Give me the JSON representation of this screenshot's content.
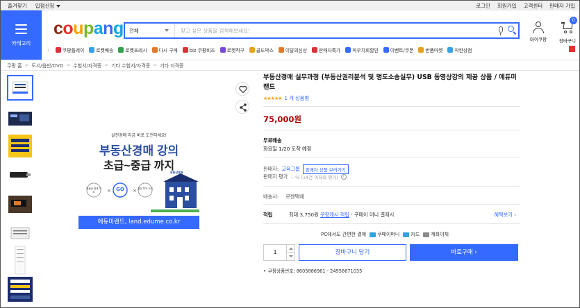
{
  "topbar": {
    "left": [
      "즐겨찾기",
      "입점신청"
    ],
    "right": [
      "로그인",
      "회원가입",
      "고객센터",
      "판매자 가입"
    ]
  },
  "category": {
    "label": "카테고리"
  },
  "logo": {
    "text": "coupang"
  },
  "search": {
    "category": "전체",
    "placeholder": "찾고 싶은 상품을 검색해보세요!"
  },
  "user": {
    "mycoupang": "마이쿠팡",
    "cart": "장바구니",
    "cart_count": "0"
  },
  "quick_nav": [
    {
      "label": "쿠팡플레이",
      "color": "#d6333a"
    },
    {
      "label": "로켓배송",
      "color": "#3aa0e6"
    },
    {
      "label": "로켓프레시",
      "color": "#2fa24a"
    },
    {
      "label": "다시 구매",
      "color": "#e07a2a"
    },
    {
      "label": "biz 쿠팡비즈",
      "color": "#d6333a"
    },
    {
      "label": "로켓직구",
      "color": "#7a4ad6"
    },
    {
      "label": "골드박스",
      "color": "#e5a21a"
    },
    {
      "label": "이달의신상",
      "color": "#e07a2a"
    },
    {
      "label": "판매자특가",
      "color": "#d6333a"
    },
    {
      "label": "파우치회할인",
      "color": "#346aff"
    },
    {
      "label": "이벤트/쿠폰",
      "color": "#346aff"
    },
    {
      "label": "반품마켓",
      "color": "#e5a21a"
    },
    {
      "label": "착한상점",
      "color": "#3aa0e6"
    }
  ],
  "breadcrumbs": [
    "쿠팡 홈",
    "도서/음반/DVD",
    "수험서/자격증",
    "기타 수험서/자격증",
    "기타 자격증"
  ],
  "product": {
    "title": "부동산경매 실무과정 (부동산권리분석 및 명도소송실무) USB 동영상강의 제공 상품 / 에듀미랜드",
    "stars": "★★★★★",
    "review_count": "1 개 상품평",
    "price": "75,000원",
    "shipping_label": "무료배송",
    "shipping_date": "화요일 1/20 도착 예정",
    "seller_label": "판매자:",
    "seller_name": "교육그룹",
    "seller_chip": "판매자 상품 보러가기",
    "score_label": "판매자 평가",
    "score_value": "-- % (14건 이하의 평가)",
    "delivery_label": "배송사:",
    "delivery_company": "로젠택배",
    "benefit_label": "적립",
    "benefit_prefix": "최대 3,750원",
    "benefit_link": "쿠팡캐시 적립",
    "benefit_suffix": "· 쿠페이 머니 결제시",
    "benefit_more": "혜택보기 ›",
    "pay_intro": "PC에서도 간편한 결제",
    "pay_methods": [
      {
        "label": "쿠페이머니",
        "color": "#2fa5e0"
      },
      {
        "label": "카드",
        "color": "#2fa5e0"
      },
      {
        "label": "계좌이체",
        "color": "#8a8a8a"
      }
    ],
    "quantity": "1",
    "cart_button": "장바구니 담기",
    "buy_button": "바로구매 ›",
    "product_number": "쿠팡상품번호: 8605886961 - 24956671035"
  },
  "main_image": {
    "headline_small": "실전경매 지금 바로 도전하세요!",
    "headline_big1": "부동산경매 강의",
    "headline_big2": "초급~중급 까지",
    "bubble_left": "부동산 경매 기초",
    "bubble_mid": "GO",
    "bubble_right": "실전 투자 수익",
    "house_tag": "부동산경매",
    "footer": "에듀미랜드, land.edume.co.kr"
  }
}
